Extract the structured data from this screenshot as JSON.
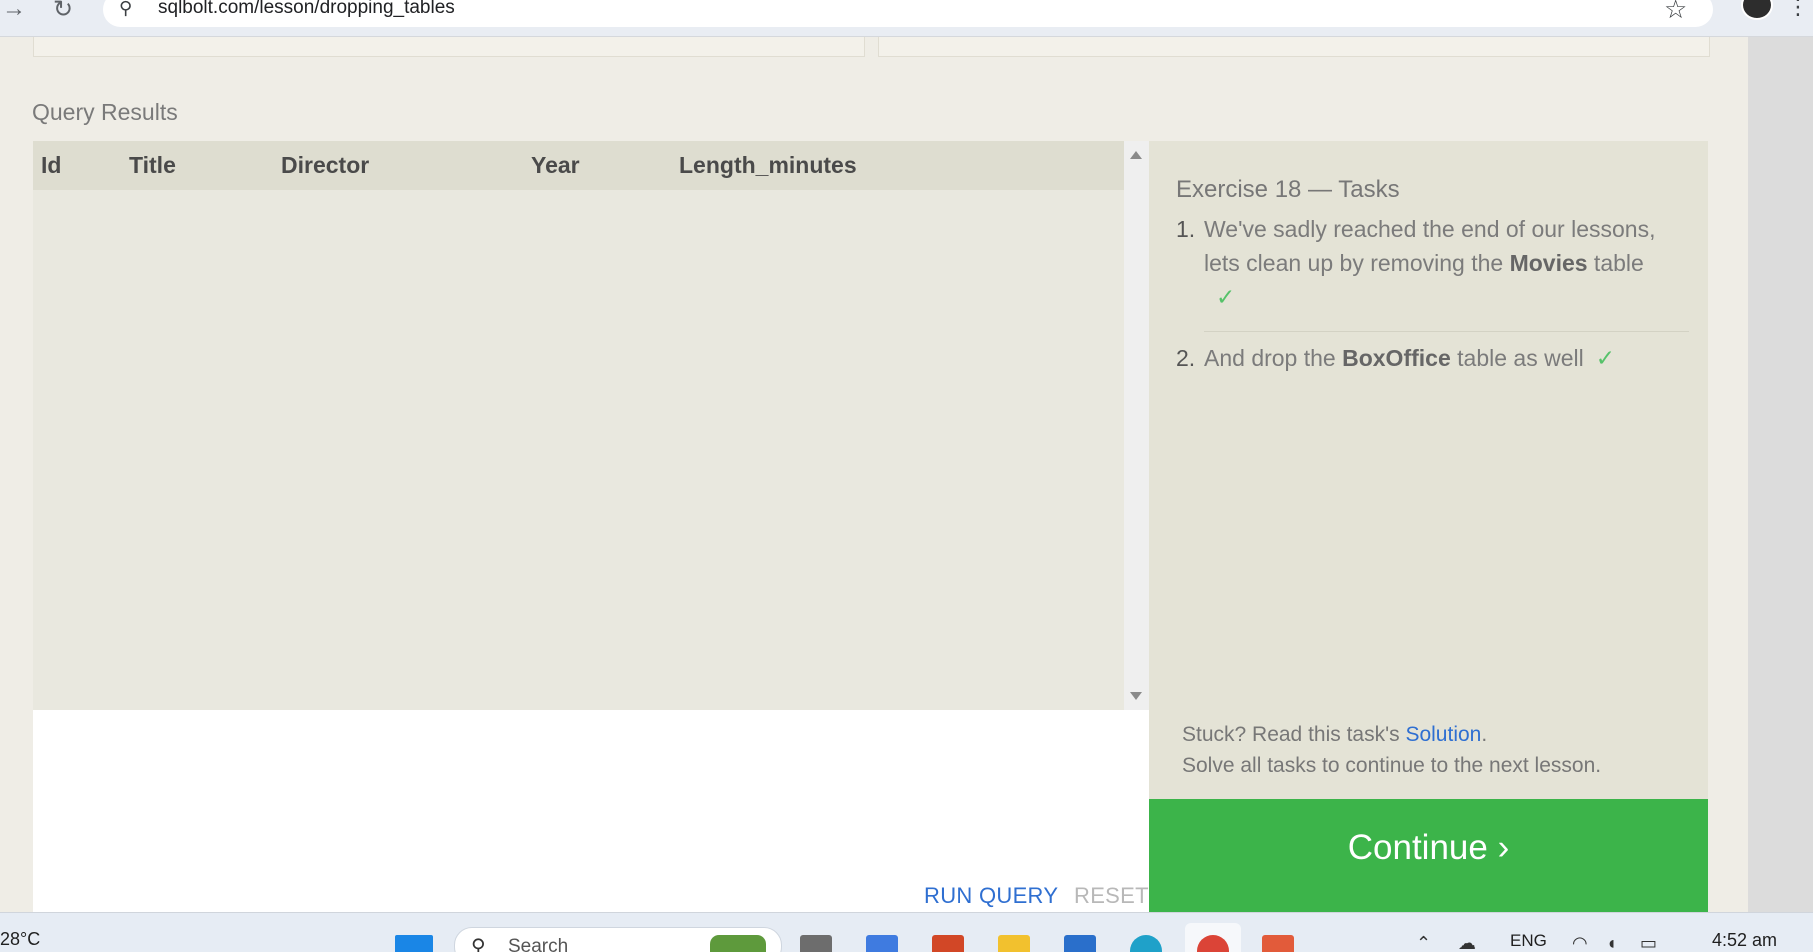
{
  "browser": {
    "url": "sqlbolt.com/lesson/dropping_tables",
    "back_icon": "→",
    "reload_icon": "↻",
    "site_info_icon": "⚲",
    "star_icon": "☆",
    "menu_icon": "⋮"
  },
  "query_results": {
    "heading": "Query Results",
    "columns": [
      "Id",
      "Title",
      "Director",
      "Year",
      "Length_minutes"
    ],
    "rows": []
  },
  "editor": {
    "run_query_label": "RUN QUERY",
    "reset_label": "RESET"
  },
  "tasks": {
    "title": "Exercise 18 — Tasks",
    "items": [
      {
        "number": "1.",
        "before": "We've sadly reached the end of our lessons, lets clean up by removing the ",
        "bold": "Movies",
        "after": " table",
        "done": true,
        "check": "✓"
      },
      {
        "number": "2.",
        "before": "And drop the ",
        "bold": "BoxOffice",
        "after": " table as well",
        "done": true,
        "check": "✓"
      }
    ],
    "stuck_prefix": "Stuck? Read this task's ",
    "solution_link": "Solution",
    "stuck_suffix": ".",
    "solve_all": "Solve all tasks to continue to the next lesson.",
    "continue_label": "Continue ›"
  },
  "taskbar": {
    "weather": "28°C",
    "search_placeholder": "Search",
    "search_icon": "⚲",
    "language": "ENG",
    "time": "4:52 am"
  },
  "colors": {
    "continue_green": "#3cb44a",
    "link_blue": "#2f6fd1",
    "check_green": "#56c26a"
  }
}
